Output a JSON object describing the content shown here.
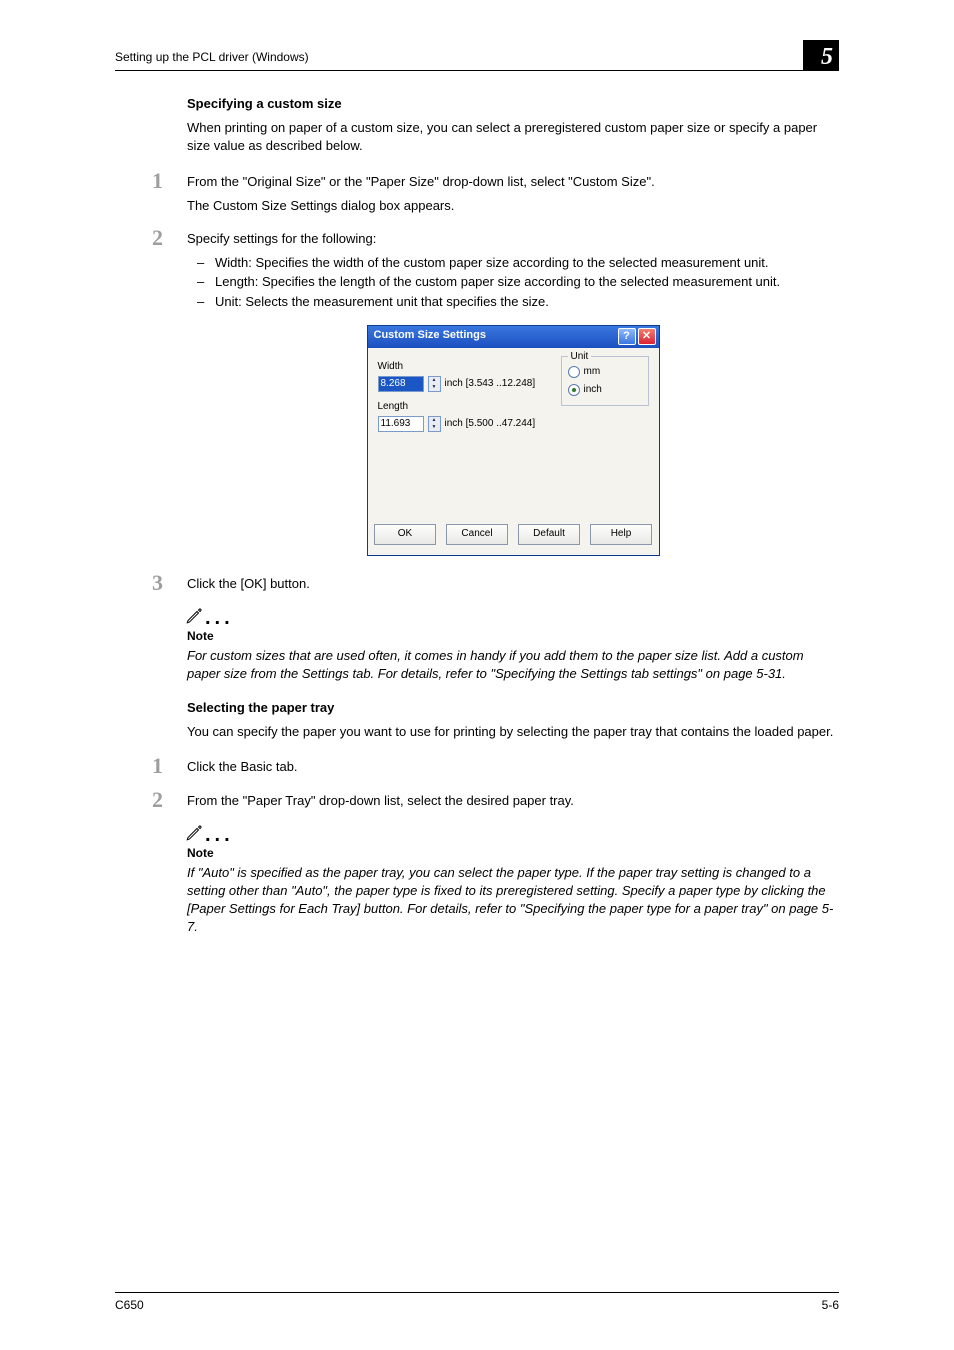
{
  "header": {
    "running": "Setting up the PCL driver (Windows)",
    "chapter": "5"
  },
  "s1": {
    "title": "Specifying a custom size",
    "intro": "When printing on paper of a custom size, you can select a preregistered custom paper size or specify a paper size value as described below.",
    "step1_a": "From the \"Original Size\" or the \"Paper Size\" drop-down list, select \"Custom Size\".",
    "step1_b": "The Custom Size Settings dialog box appears.",
    "step2_lead": "Specify settings for the following:",
    "b1": "Width: Specifies the width of the custom paper size according to the selected measurement unit.",
    "b2": "Length: Specifies the length of the custom paper size according to the selected measurement unit.",
    "b3": "Unit: Selects the measurement unit that specifies the size.",
    "step3": "Click the [OK] button."
  },
  "dialog": {
    "title": "Custom Size Settings",
    "help": "?",
    "close": "✕",
    "width_label": "Width",
    "width_value": "8.268",
    "width_range": "inch [3.543 ..12.248]",
    "length_label": "Length",
    "length_value": "11.693",
    "length_range": "inch [5.500 ..47.244]",
    "unit_legend": "Unit",
    "unit_mm": "mm",
    "unit_inch": "inch",
    "ok": "OK",
    "cancel": "Cancel",
    "default": "Default",
    "helpbtn": "Help"
  },
  "note1": {
    "label": "Note",
    "text": "For custom sizes that are used often, it comes in handy if you add them to the paper size list. Add a custom paper size from the Settings tab. For details, refer to \"Specifying the Settings tab settings\" on page 5-31."
  },
  "s2": {
    "title": "Selecting the paper tray",
    "intro": "You can specify the paper you want to use for printing by selecting the paper tray that contains the loaded paper.",
    "step1": "Click the Basic tab.",
    "step2": "From the \"Paper Tray\" drop-down list, select the desired paper tray."
  },
  "note2": {
    "label": "Note",
    "text": "If \"Auto\" is specified as the paper tray, you can select the paper type. If the paper tray setting is changed to a setting other than \"Auto\", the paper type is fixed to its preregistered setting. Specify a paper type by clicking the [Paper Settings for Each Tray] button. For details, refer to \"Specifying the paper type for a paper tray\" on page 5-7."
  },
  "footer": {
    "model": "C650",
    "page": "5-6"
  },
  "nums": {
    "n1": "1",
    "n2": "2",
    "n3": "3"
  }
}
